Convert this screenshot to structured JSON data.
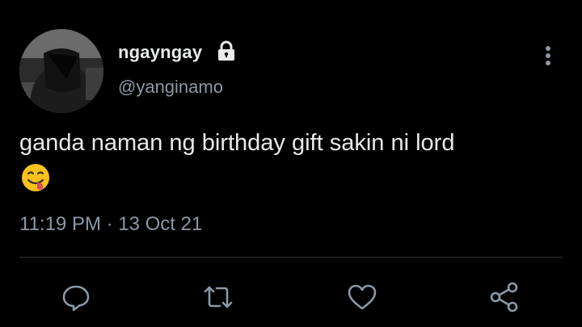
{
  "user": {
    "display_name": "ngayngay",
    "handle": "@yanginamo",
    "protected_icon": "lock-icon",
    "avatar": "avatar"
  },
  "tweet": {
    "text": "ganda naman ng birthday gift sakin ni lord",
    "emoji": "face-savoring-food-emoji",
    "timestamp": "11:19 PM · 13 Oct 21"
  },
  "menu": {
    "icon": "more-vertical-icon"
  },
  "actions": [
    {
      "name": "reply",
      "icon": "comment-icon"
    },
    {
      "name": "retweet",
      "icon": "retweet-icon"
    },
    {
      "name": "like",
      "icon": "heart-icon"
    },
    {
      "name": "share",
      "icon": "share-icon"
    }
  ],
  "colors": {
    "background": "#000000",
    "primary_text": "#e7e9ea",
    "secondary_text": "#8b98a5",
    "divider": "#2f3336"
  }
}
